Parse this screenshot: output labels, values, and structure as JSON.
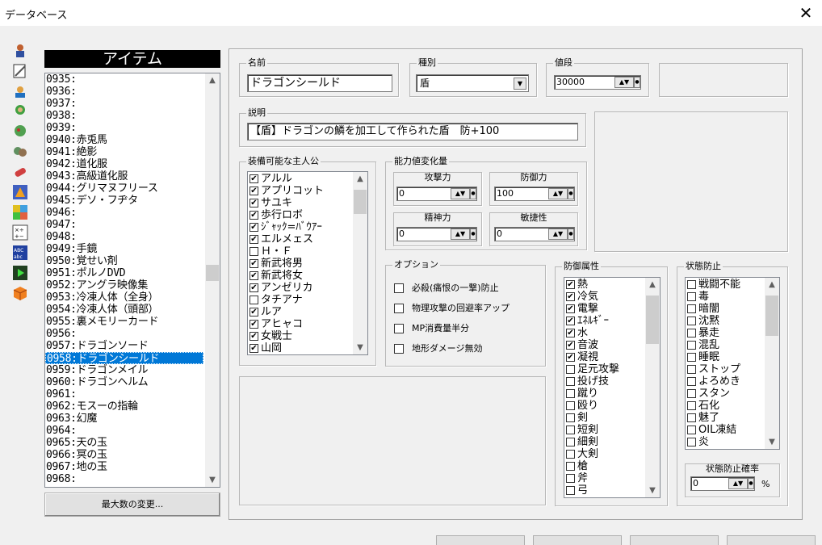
{
  "window": {
    "title": "データベース",
    "close": "✕"
  },
  "sidebar_icons": [
    "hero-icon",
    "weapon-icon",
    "item-icon",
    "character-icon",
    "enemy-icon",
    "party-icon",
    "capsule-icon",
    "animation-icon",
    "tileset-icon",
    "system-icon",
    "terms-icon",
    "event-icon",
    "box-icon"
  ],
  "list": {
    "heading": "アイテム",
    "rows": [
      "0935:",
      "0936:",
      "0937:",
      "0938:",
      "0939:",
      "0940:赤兎馬",
      "0941:絶影",
      "0942:道化服",
      "0943:高級道化服",
      "0944:グリマヌフリース",
      "0945:デソ・フヂタ",
      "0946:",
      "0947:",
      "0948:",
      "0949:手鏡",
      "0950:覚せい剤",
      "0951:ポルノDVD",
      "0952:アングラ映像集",
      "0953:冷凍人体（全身）",
      "0954:冷凍人体（頭部）",
      "0955:裏メモリーカード",
      "0956:",
      "0957:ドラゴンソード",
      "0958:ドラゴンシールド",
      "0959:ドラゴンメイル",
      "0960:ドラゴンヘルム",
      "0961:",
      "0962:モスーの指輪",
      "0963:幻魔",
      "0964:",
      "0965:天の玉",
      "0966:冥の玉",
      "0967:地の玉",
      "0968:"
    ],
    "selected_index": 23,
    "max_button": "最大数の変更..."
  },
  "name": {
    "label": "名前",
    "value": "ドラゴンシールド"
  },
  "kind": {
    "label": "種別",
    "value": "盾"
  },
  "price": {
    "label": "値段",
    "value": "30000"
  },
  "desc": {
    "label": "説明",
    "value": "【盾】ドラゴンの鱗を加工して作られた盾　防+100"
  },
  "heroes": {
    "label": "装備可能な主人公",
    "items": [
      {
        "name": "アルル",
        "checked": true
      },
      {
        "name": "アプリコット",
        "checked": true
      },
      {
        "name": "サユキ",
        "checked": true
      },
      {
        "name": "歩行ロボ",
        "checked": true
      },
      {
        "name": "ｼﾞｬｯｸ=ﾊﾞｳｱｰ",
        "checked": true
      },
      {
        "name": "エルメェス",
        "checked": true
      },
      {
        "name": "Ｈ・Ｆ",
        "checked": false
      },
      {
        "name": "新武将男",
        "checked": true
      },
      {
        "name": "新武将女",
        "checked": true
      },
      {
        "name": "アンゼリカ",
        "checked": true
      },
      {
        "name": "タチアナ",
        "checked": false
      },
      {
        "name": "ルア",
        "checked": true
      },
      {
        "name": "アヒャコ",
        "checked": true
      },
      {
        "name": "女戦士",
        "checked": true
      },
      {
        "name": "山岡",
        "checked": true
      }
    ]
  },
  "stats": {
    "label": "能力値変化量",
    "attack": {
      "label": "攻撃力",
      "value": "0"
    },
    "defense": {
      "label": "防御力",
      "value": "100"
    },
    "spirit": {
      "label": "精神力",
      "value": "0"
    },
    "agility": {
      "label": "敏捷性",
      "value": "0"
    }
  },
  "options": {
    "label": "オプション",
    "items": [
      "必殺(痛恨の一撃)防止",
      "物理攻撃の回避率アップ",
      "MP消費量半分",
      "地形ダメージ無効"
    ]
  },
  "defense_attr": {
    "label": "防御属性",
    "items": [
      {
        "name": "熱",
        "checked": true
      },
      {
        "name": "冷気",
        "checked": true
      },
      {
        "name": "電撃",
        "checked": true
      },
      {
        "name": "ｴﾈﾙｷﾞｰ",
        "checked": true
      },
      {
        "name": "水",
        "checked": true
      },
      {
        "name": "音波",
        "checked": true
      },
      {
        "name": "凝視",
        "checked": true
      },
      {
        "name": "足元攻撃",
        "checked": false
      },
      {
        "name": "投げ技",
        "checked": false
      },
      {
        "name": "蹴り",
        "checked": false
      },
      {
        "name": "殴り",
        "checked": false
      },
      {
        "name": "剣",
        "checked": false
      },
      {
        "name": "短剣",
        "checked": false
      },
      {
        "name": "細剣",
        "checked": false
      },
      {
        "name": "大剣",
        "checked": false
      },
      {
        "name": "槍",
        "checked": false
      },
      {
        "name": "斧",
        "checked": false
      },
      {
        "name": "弓",
        "checked": false
      }
    ]
  },
  "status_prevent": {
    "label": "状態防止",
    "items": [
      "戦闘不能",
      "毒",
      "暗闇",
      "沈黙",
      "暴走",
      "混乱",
      "睡眠",
      "ストップ",
      "よろめき",
      "スタン",
      "石化",
      "魅了",
      "OIL凍結",
      "炎"
    ],
    "rate_label": "状態防止確率",
    "rate_value": "0",
    "rate_unit": "%"
  }
}
